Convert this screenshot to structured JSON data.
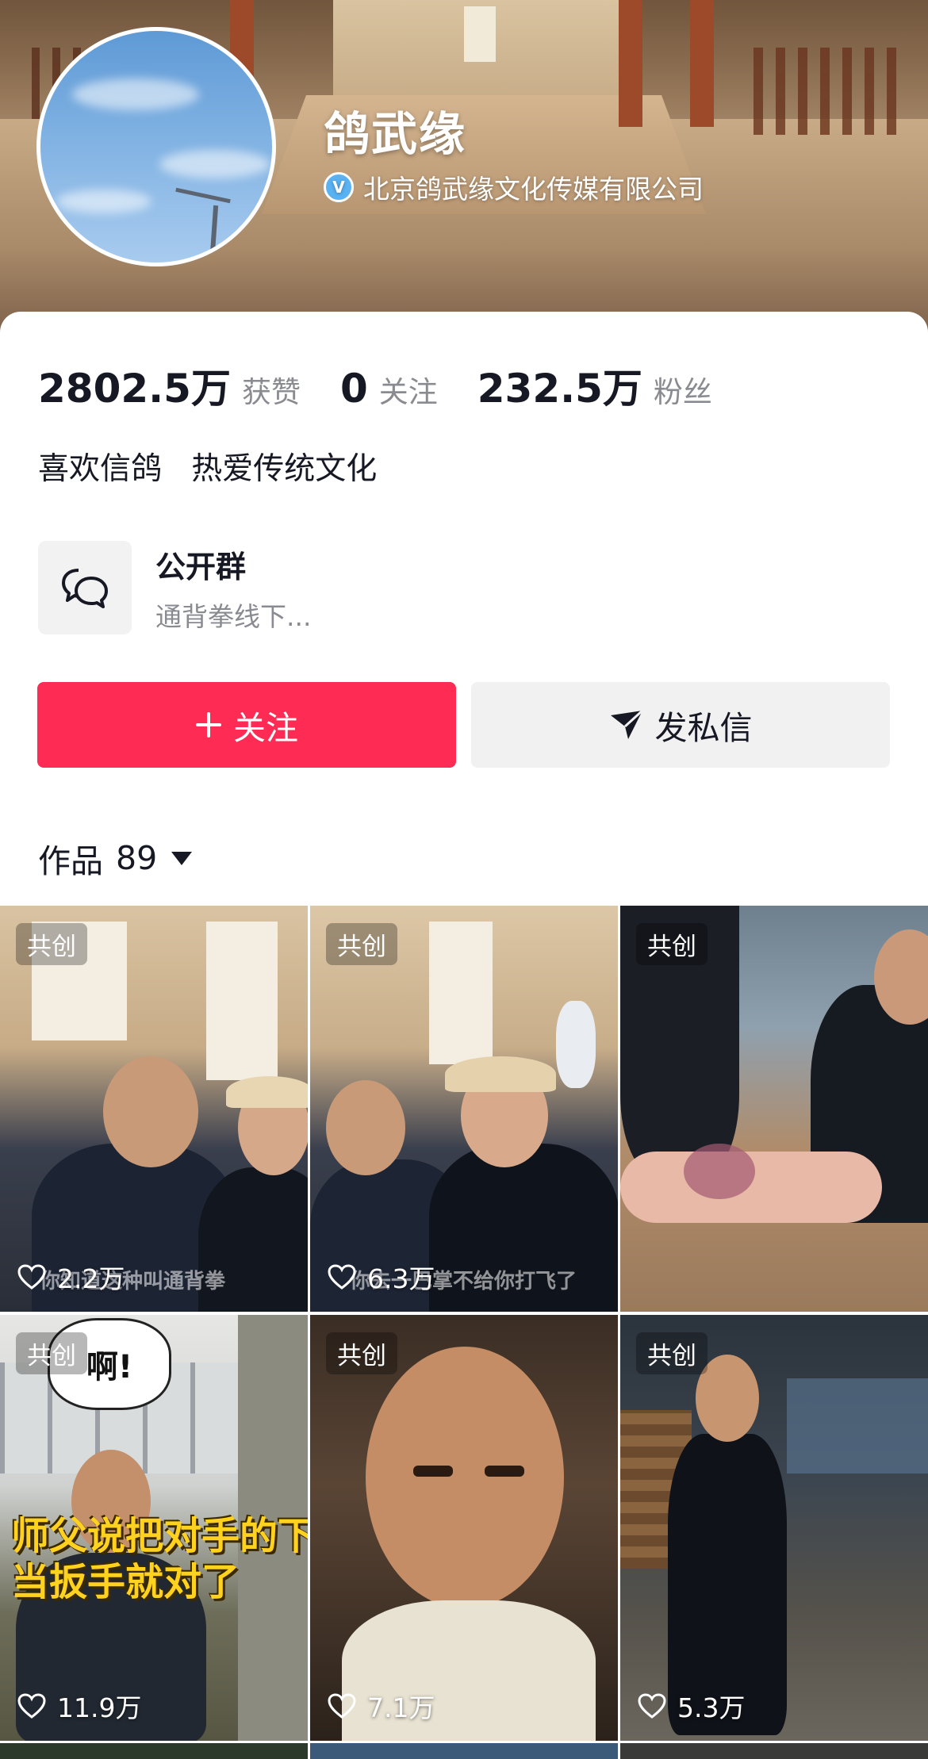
{
  "profile": {
    "name": "鸽武缘",
    "verified_org": "北京鸽武缘文化传媒有限公司",
    "verified_icon": "verified-v-icon"
  },
  "stats": {
    "likes_value": "2802.5万",
    "likes_label": "获赞",
    "following_value": "0",
    "following_label": "关注",
    "followers_value": "232.5万",
    "followers_label": "粉丝"
  },
  "bio": "喜欢信鸽   热爱传统文化",
  "group": {
    "title": "公开群",
    "subtitle": "通背拳线下..."
  },
  "buttons": {
    "follow": "关注",
    "message": "发私信"
  },
  "works": {
    "label": "作品",
    "count": "89"
  },
  "videos": [
    {
      "badge": "共创",
      "likes": "2.2万",
      "caption": "你知道这种叫通背拳"
    },
    {
      "badge": "共创",
      "likes": "6.3万",
      "caption": "你去一巴掌不给你打飞了"
    },
    {
      "badge": "共创",
      "likes": "",
      "caption": ""
    },
    {
      "badge": "共创",
      "likes": "11.9万",
      "overlay": "师父说把对手的下巴\n当扳手就对了",
      "bubble": "啊!"
    },
    {
      "badge": "共创",
      "likes": "7.1万",
      "caption": ""
    },
    {
      "badge": "共创",
      "likes": "5.3万",
      "caption": ""
    }
  ],
  "colors": {
    "follow_button": "#fe2c55",
    "message_button": "#f1f1f2",
    "primary_text": "#161823",
    "secondary_text": "#8a8b91",
    "verified_badge": "#5ab2f3"
  }
}
